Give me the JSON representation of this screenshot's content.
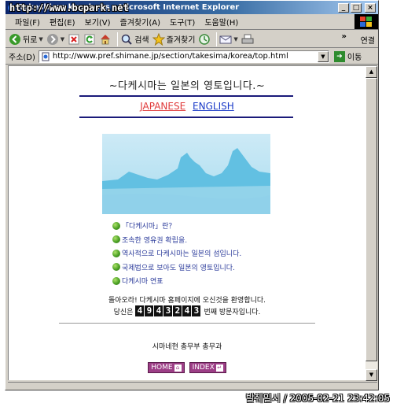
{
  "window": {
    "title": "Takeshima kyoshohs - Microsoft Internet Explorer"
  },
  "menu": [
    "파일(F)",
    "편집(E)",
    "보기(V)",
    "즐겨찾기(A)",
    "도구(T)",
    "도움말(H)"
  ],
  "toolbar": {
    "back": "뒤로",
    "search": "검색",
    "favorites": "즐겨찾기",
    "links": "연결",
    "chevron": "»"
  },
  "address": {
    "label": "주소(D)",
    "url": "http://www.pref.shimane.jp/section/takesima/korea/top.html",
    "go": "이동"
  },
  "page": {
    "headline": "~다케시마는 일본의 영토입니다.~",
    "lang_japanese": "JAPANESE",
    "lang_english": "ENGLISH",
    "links": [
      "「다케시마」란？",
      "조속한 영유권 확립을.",
      "역사적으로 다케시마는 일본의 섬입니다.",
      "국제법으로 보아도 일본의 영토입니다.",
      "다케시마 연표"
    ],
    "welcome": "돌아오라! 다케시마 홈페이지에 오신것을 환영합니다.",
    "counter_prefix": "당신은",
    "counter_digits": [
      "4",
      "9",
      "4",
      "3",
      "2",
      "4",
      "3"
    ],
    "counter_suffix": "번째 방문자입니다.",
    "department": "시마네현 총무부 총무과",
    "home_button": "HOME",
    "index_button": "INDEX"
  },
  "watermark": {
    "top": "http://www.bcpark.net",
    "bottom": "발췌일시 / 2005-02-21 23:42:05"
  },
  "colors": {
    "link_red": "#e03a3a",
    "link_blue": "#1a3ac8",
    "rule_navy": "#1a1a7a",
    "nav_button": "#9c3e86",
    "photo_sea": "#bfe4f2",
    "photo_rock": "#5fbfe0"
  }
}
